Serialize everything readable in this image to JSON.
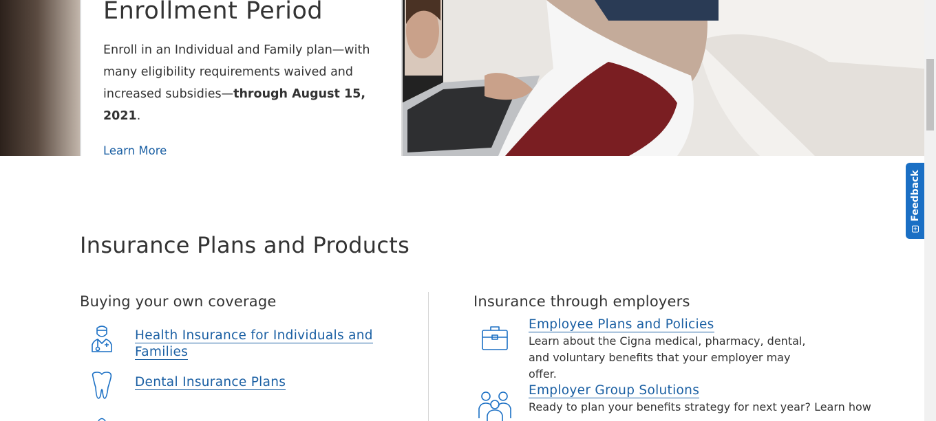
{
  "promo": {
    "title": "Enrollment Period",
    "body_prefix": "Enroll in an Individual and Family plan—with many eligibility requirements waived and increased subsidies—",
    "body_bold": "through August 15, 2021",
    "body_suffix": ".",
    "link": "Learn More"
  },
  "feedback": {
    "label": "Feedback"
  },
  "section": {
    "title": "Insurance Plans and Products"
  },
  "left_column": {
    "title": "Buying your own coverage",
    "items": [
      {
        "label": "Health Insurance for Individuals and Families",
        "icon": "doctor-icon"
      },
      {
        "label": "Dental Insurance Plans",
        "icon": "tooth-icon"
      }
    ]
  },
  "right_column": {
    "title": "Insurance through employers",
    "items": [
      {
        "label": "Employee Plans and Policies",
        "description": "Learn about the Cigna medical, pharmacy, dental, and voluntary benefits that your employer may offer.",
        "icon": "briefcase-icon"
      },
      {
        "label": "Employer Group Solutions",
        "description": "Ready to plan your benefits strategy for next year? Learn how",
        "icon": "group-icon"
      }
    ]
  },
  "colors": {
    "link": "#1a5fa3",
    "feedback_bg": "#1a6fc4",
    "text": "#333333"
  }
}
